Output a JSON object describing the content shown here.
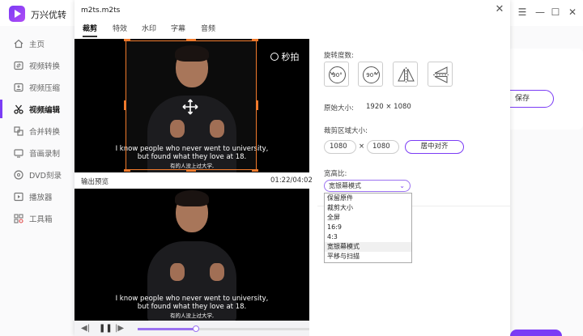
{
  "app": {
    "title": "万兴优转",
    "bg_save_label": "保存"
  },
  "sidebar": {
    "items": [
      {
        "label": "主页",
        "icon": "home-icon"
      },
      {
        "label": "视频转换",
        "icon": "convert-icon"
      },
      {
        "label": "视频压缩",
        "icon": "compress-icon"
      },
      {
        "label": "视频编辑",
        "icon": "scissors-icon",
        "active": true
      },
      {
        "label": "合并转换",
        "icon": "merge-icon"
      },
      {
        "label": "音画录制",
        "icon": "record-icon"
      },
      {
        "label": "DVD刻录",
        "icon": "dvd-icon"
      },
      {
        "label": "播放器",
        "icon": "player-icon"
      },
      {
        "label": "工具箱",
        "icon": "toolbox-icon"
      }
    ]
  },
  "dialog": {
    "title": "m2ts.m2ts",
    "close": "✕",
    "tabs": [
      {
        "label": "裁剪",
        "active": true
      },
      {
        "label": "特效"
      },
      {
        "label": "水印"
      },
      {
        "label": "字幕"
      },
      {
        "label": "音频"
      }
    ],
    "video": {
      "watermark": "秒拍",
      "subtitle_line1": "I know people who never went to university,",
      "subtitle_line2": "but found what they love at 18.",
      "subtitle_cn": "有的人没上过大学,"
    },
    "preview_label": "输出预览",
    "timecode": "01:22/04:02",
    "progress": 0.34,
    "settings": {
      "rotation_label": "旋转度数:",
      "rotate_cw": "90°",
      "rotate_ccw": "90°",
      "original_size_label": "原始大小:",
      "original_size_value": "1920 × 1080",
      "crop_size_label": "裁剪区域大小:",
      "crop_width": "1080",
      "crop_x": "×",
      "crop_height": "1080",
      "center_button": "居中对齐",
      "aspect_label": "宽高比:",
      "aspect_selected": "宽银幕模式",
      "aspect_options": [
        "保留原件",
        "裁剪大小",
        "全屏",
        "16:9",
        "4:3",
        "宽银幕模式",
        "平移与扫描"
      ]
    }
  },
  "colors": {
    "accent": "#7b3cf5",
    "crop_frame": "#f07a2c"
  }
}
